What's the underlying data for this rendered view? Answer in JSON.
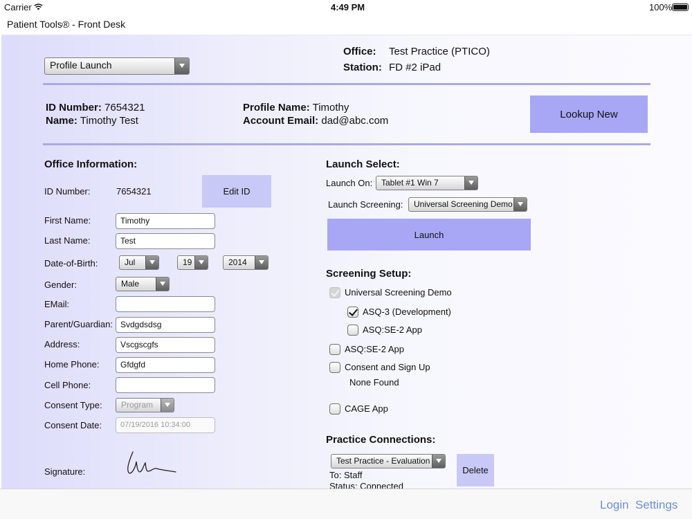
{
  "status_bar": {
    "carrier": "Carrier",
    "time": "4:49 PM",
    "battery": "100%"
  },
  "app_title": "Patient Tools® - Front Desk",
  "header": {
    "profile_dropdown": "Profile Launch",
    "office_label": "Office:",
    "office_value": "Test Practice (PTICO)",
    "station_label": "Station:",
    "station_value": "FD #2 iPad"
  },
  "patient_summary": {
    "id_label": "ID Number:",
    "id_value": "7654321",
    "name_label": "Name:",
    "name_value": "Timothy Test",
    "profile_label": "Profile Name:",
    "profile_value": "Timothy",
    "email_label": "Account Email:",
    "email_value": "dad@abc.com",
    "lookup_button": "Lookup New"
  },
  "office_info": {
    "title": "Office Information:",
    "id_label": "ID Number:",
    "id_value": "7654321",
    "edit_id_button": "Edit ID",
    "first_name_label": "First Name:",
    "first_name": "Timothy",
    "last_name_label": "Last Name:",
    "last_name": "Test",
    "dob_label": "Date-of-Birth:",
    "dob_month": "Jul",
    "dob_day": "19",
    "dob_year": "2014",
    "gender_label": "Gender:",
    "gender": "Male",
    "email_label": "EMail:",
    "email": "",
    "guardian_label": "Parent/Guardian:",
    "guardian": "Svdgdsdsg",
    "address_label": "Address:",
    "address": "Vscgscgfs",
    "home_phone_label": "Home Phone:",
    "home_phone": "Gfdgfd",
    "cell_phone_label": "Cell Phone:",
    "cell_phone": "",
    "consent_type_label": "Consent Type:",
    "consent_type": "Program",
    "consent_date_label": "Consent Date:",
    "consent_date": "07/19/2016 10:34:00",
    "signature_label": "Signature:"
  },
  "launch_select": {
    "title": "Launch Select:",
    "launch_on_label": "Launch On:",
    "launch_on": "Tablet #1 Win 7",
    "screening_label": "Launch Screening:",
    "screening": "Universal Screening Demo",
    "launch_button": "Launch"
  },
  "screening_setup": {
    "title": "Screening Setup:",
    "items": [
      {
        "label": "Universal Screening Demo",
        "checked": true,
        "disabled": true
      },
      {
        "label": "ASQ-3 (Development)",
        "checked": true
      },
      {
        "label": "ASQ:SE-2 App",
        "checked": false
      },
      {
        "label": "ASQ:SE-2 App",
        "checked": false
      },
      {
        "label": "Consent and Sign Up",
        "checked": false
      },
      {
        "label": "CAGE App",
        "checked": false
      }
    ],
    "none_found": "None Found"
  },
  "practice_connections": {
    "title": "Practice Connections:",
    "selected": "Test Practice - Evaluation",
    "to": "To: Staff",
    "status": "Status: Connected",
    "delete_button": "Delete"
  },
  "footer": {
    "login": "Login",
    "settings": "Settings"
  },
  "colors": {
    "accent_button": "#a7a7f5",
    "separator": "#a9a9e8",
    "link": "#6b8fd6"
  }
}
